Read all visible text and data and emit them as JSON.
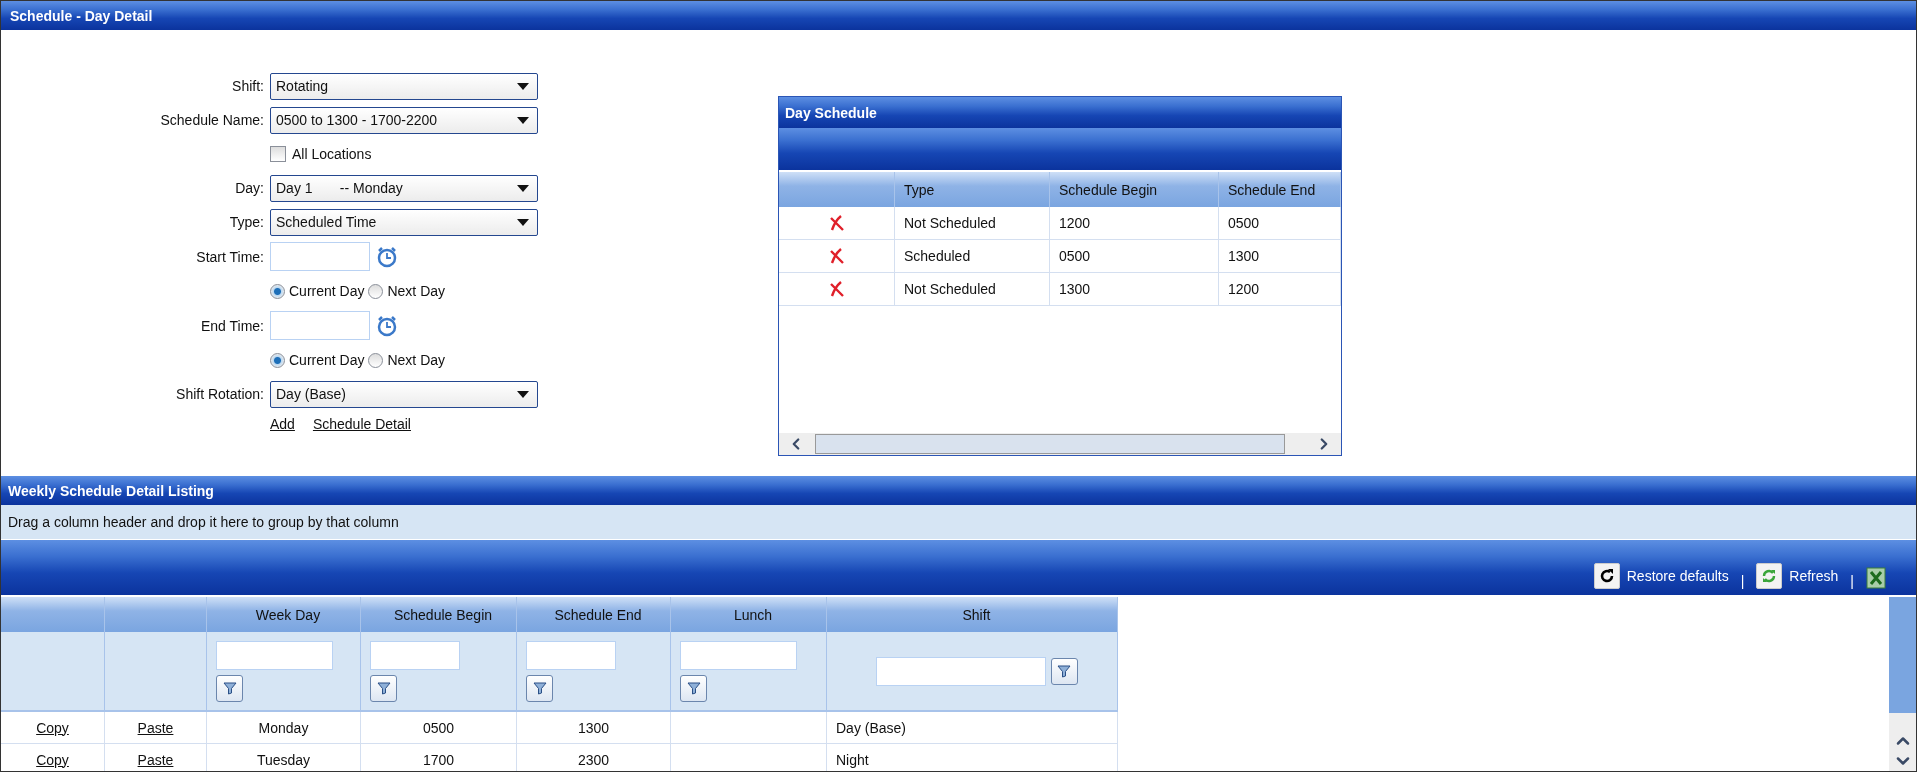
{
  "title": "Schedule - Day Detail",
  "form": {
    "fields": [
      {
        "kind": "select",
        "label": "Shift:",
        "value": "Rotating"
      },
      {
        "kind": "select",
        "label": "Schedule Name:",
        "value": "0500 to 1300 - 1700-2200"
      },
      {
        "kind": "checkbox",
        "label": "All Locations",
        "checked": false
      },
      {
        "kind": "select",
        "label": "Day:",
        "value": "Day 1       -- Monday"
      },
      {
        "kind": "select",
        "label": "Type:",
        "value": "Scheduled Time"
      },
      {
        "kind": "time",
        "label": "Start Time:"
      },
      {
        "kind": "radio",
        "options": [
          {
            "label": "Current Day",
            "selected": true
          },
          {
            "label": "Next Day",
            "selected": false
          }
        ]
      },
      {
        "kind": "time",
        "label": "End Time:"
      },
      {
        "kind": "radio",
        "options": [
          {
            "label": "Current Day",
            "selected": true
          },
          {
            "label": "Next Day",
            "selected": false
          }
        ]
      },
      {
        "kind": "select",
        "label": "Shift Rotation:",
        "value": "Day (Base)"
      }
    ],
    "links": [
      "Add",
      "Schedule Detail"
    ]
  },
  "day_schedule": {
    "title": "Day Schedule",
    "columns": [
      "Type",
      "Schedule Begin",
      "Schedule End"
    ],
    "rows": [
      {
        "type": "Not Scheduled",
        "begin": "1200",
        "end": "0500"
      },
      {
        "type": "Scheduled",
        "begin": "0500",
        "end": "1300"
      },
      {
        "type": "Not Scheduled",
        "begin": "1300",
        "end": "1200"
      }
    ]
  },
  "weekly": {
    "title": "Weekly Schedule Detail Listing",
    "group_hint": "Drag a column header and drop it here to group by that column",
    "toolbar": [
      {
        "kind": "restore",
        "label": "Restore defaults"
      },
      {
        "kind": "separator",
        "label": "|"
      },
      {
        "kind": "refresh",
        "label": "Refresh"
      },
      {
        "kind": "separator",
        "label": "|"
      },
      {
        "kind": "export"
      }
    ],
    "columns": [
      "Week Day",
      "Schedule Begin",
      "Schedule End",
      "Lunch",
      "Shift"
    ],
    "rows": [
      {
        "copy": "Copy",
        "paste": "Paste",
        "cells": [
          "Monday",
          "0500",
          "1300",
          null,
          "Day (Base)"
        ]
      },
      {
        "copy": "Copy",
        "paste": "Paste",
        "cells": [
          "Tuesday",
          "1700",
          "2300",
          null,
          "Night"
        ]
      }
    ]
  }
}
